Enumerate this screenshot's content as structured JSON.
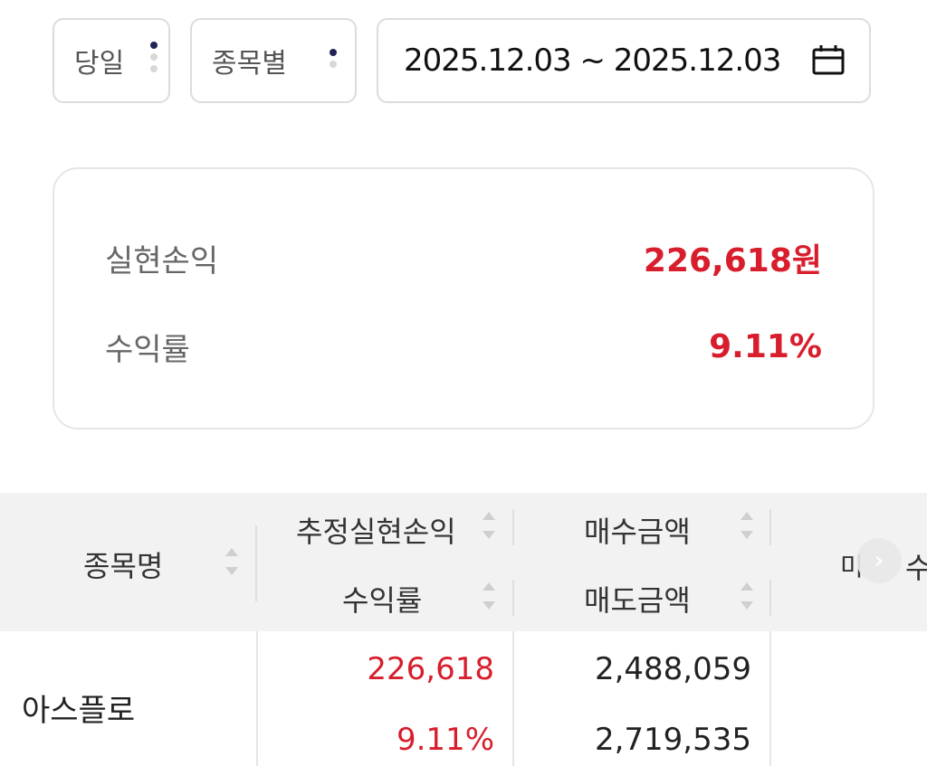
{
  "filters": {
    "period": "당일",
    "group": "종목별",
    "date_range": "2025.12.03 ~ 2025.12.03"
  },
  "summary": {
    "realized_pnl_label": "실현손익",
    "realized_pnl_value": "226,618원",
    "return_rate_label": "수익률",
    "return_rate_value": "9.11%"
  },
  "table": {
    "headers": {
      "stock_name": "종목명",
      "est_realized_pnl": "추정실현손익",
      "return_rate": "수익률",
      "buy_amount": "매수금액",
      "sell_amount": "매도금액",
      "clipped_col_a": "미",
      "clipped_col_b": "수"
    },
    "rows": [
      {
        "stock_name": "아스플로",
        "est_realized_pnl": "226,618",
        "return_rate": "9.11%",
        "buy_amount": "2,488,059",
        "sell_amount": "2,719,535"
      }
    ]
  },
  "colors": {
    "positive": "#d81e2c",
    "header_bg": "#f2f2f2",
    "select_dot_active": "#1f2357"
  },
  "icons": [
    "calendar-icon",
    "sort-icon",
    "chevron-right-icon",
    "select-dots-icon"
  ]
}
